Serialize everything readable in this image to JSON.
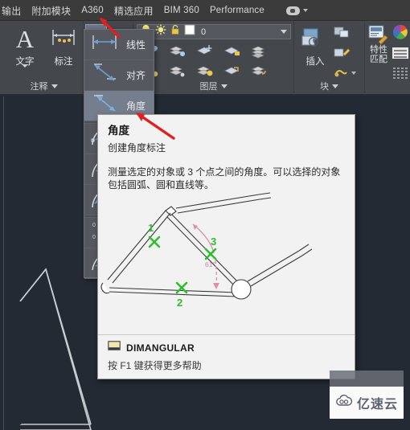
{
  "menubar": {
    "tabs": [
      {
        "label": "输出",
        "name": "tab-output"
      },
      {
        "label": "附加模块",
        "name": "tab-addins"
      },
      {
        "label": "A360",
        "name": "tab-a360"
      },
      {
        "label": "精选应用",
        "name": "tab-featured-apps"
      },
      {
        "label": "BIM 360",
        "name": "tab-bim360"
      },
      {
        "label": "Performance",
        "name": "tab-performance"
      }
    ]
  },
  "ribbon": {
    "panels": [
      {
        "title": "注释 ",
        "name": "panel-annotation"
      },
      {
        "title": "图层 ",
        "name": "panel-layers"
      },
      {
        "title": "块 ",
        "name": "panel-block"
      }
    ],
    "annotation": {
      "text_button": "文字",
      "dimension_button": "标注",
      "panel_title": "注释"
    },
    "layers": {
      "current_layer": "0",
      "panel_title": "图层",
      "icons": [
        "lightbulb-icon",
        "sun-icon",
        "lock-icon",
        "color-swatch-icon"
      ]
    },
    "block": {
      "insert_button": "插入",
      "panel_title": "块"
    },
    "properties": {
      "match_button_line1": "特性",
      "match_button_line2": "匹配"
    }
  },
  "flyout": {
    "items": [
      {
        "label": "线性",
        "name": "flyout-item-linear",
        "icon": "linear-dimension-icon",
        "highlighted": false
      },
      {
        "label": "对齐",
        "name": "flyout-item-aligned",
        "icon": "aligned-dimension-icon",
        "highlighted": false
      },
      {
        "label": "角度",
        "name": "flyout-item-angular",
        "icon": "angular-dimension-icon",
        "highlighted": true
      },
      {
        "label": "",
        "name": "flyout-item-arclength",
        "icon": "arc-length-dimension-icon",
        "highlighted": false
      },
      {
        "label": "",
        "name": "flyout-item-radius",
        "icon": "radius-dimension-icon",
        "highlighted": false
      },
      {
        "label": "",
        "name": "flyout-item-diameter",
        "icon": "diameter-dimension-icon",
        "highlighted": false
      },
      {
        "label": "",
        "name": "flyout-item-ordinate",
        "icon": "ordinate-dimension-icon",
        "highlighted": false
      },
      {
        "label": "",
        "name": "flyout-item-jogged",
        "icon": "jogged-dimension-icon",
        "highlighted": false
      }
    ]
  },
  "tooltip": {
    "title": "角度",
    "subtitle": "创建角度标注",
    "description": "测量选定的对象或 3 个点之间的角度。可以选择的对象包括圆弧、圆和直线等。",
    "command": "DIMANGULAR",
    "help_hint": "按 F1 键获得更多帮助",
    "illustration": {
      "name": "bicycle-frame-angular-dimension-illustration",
      "markers": [
        "1",
        "2",
        "3"
      ],
      "angle_label": "61°",
      "marker_color": "#33bb33",
      "dimension_color": "#e08090"
    }
  },
  "canvas": {
    "shape": "triangle-outline",
    "line_color": "#c9ccd2",
    "background": "#242a33"
  },
  "watermark": {
    "text": "亿速云",
    "icon": "cloud-icon"
  }
}
